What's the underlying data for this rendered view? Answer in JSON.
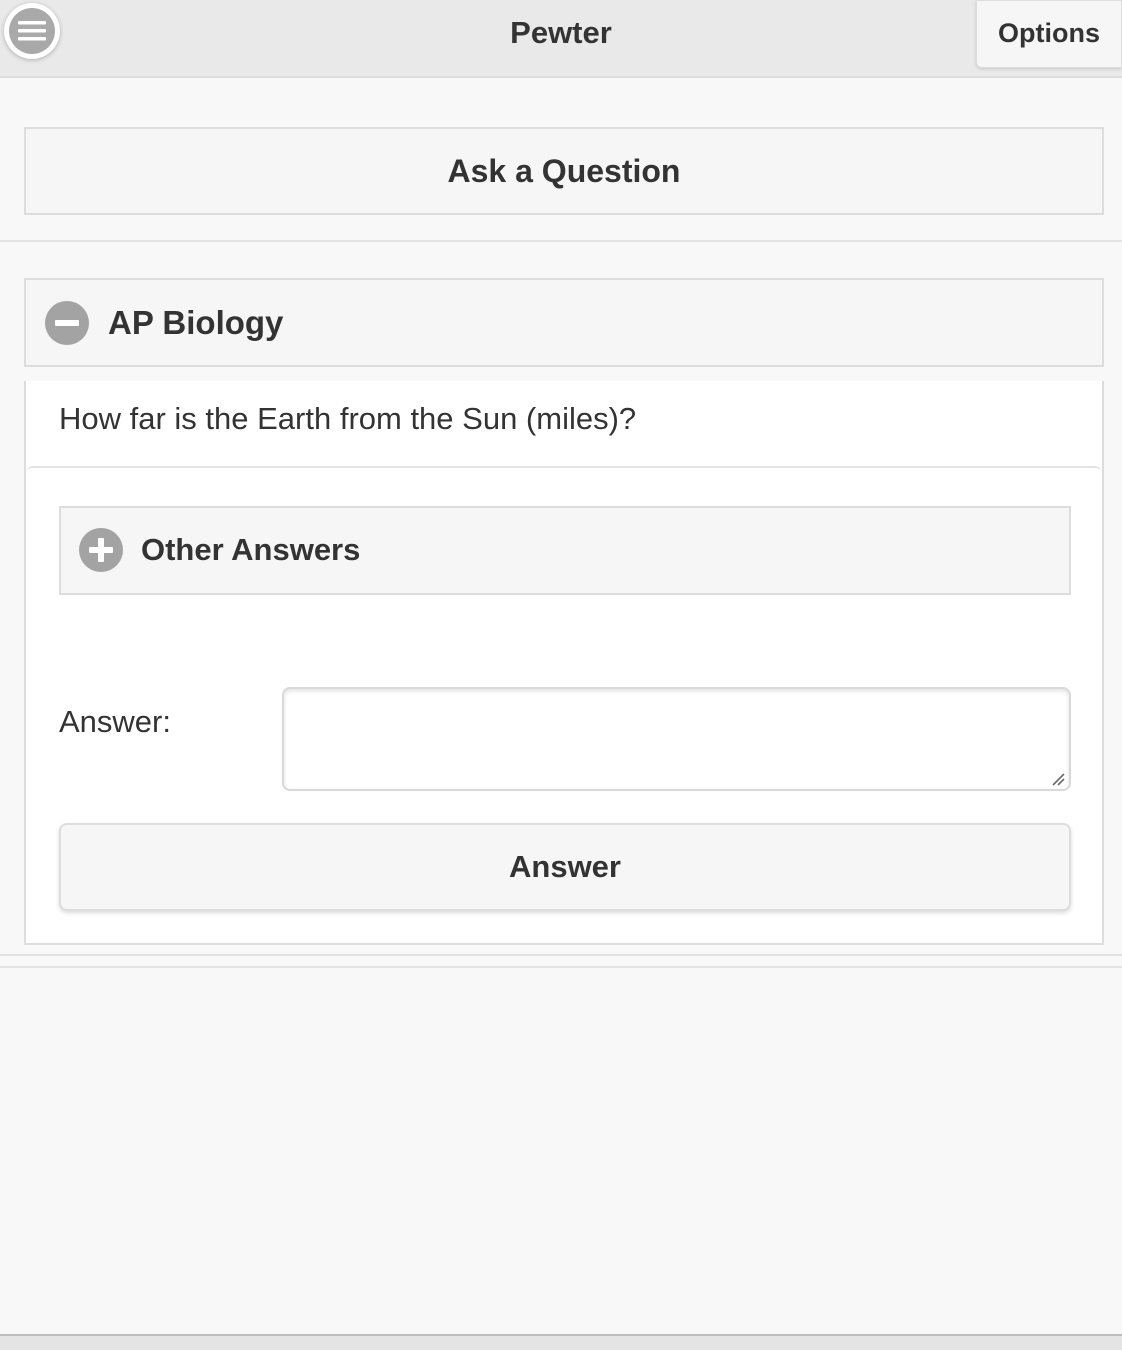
{
  "header": {
    "title": "Pewter",
    "options_label": "Options",
    "menu_icon": "hamburger-menu-icon"
  },
  "ask": {
    "label": "Ask a Question"
  },
  "subject": {
    "title": "AP Biology",
    "icon": "minus-circle-icon",
    "expanded": true
  },
  "question": {
    "text": "How far is the Earth from the Sun (miles)?"
  },
  "other_answers": {
    "title": "Other Answers",
    "icon": "plus-circle-icon",
    "expanded": false
  },
  "answer_form": {
    "label": "Answer:",
    "value": "",
    "button_label": "Answer"
  },
  "colors": {
    "header_bg": "#e9e9e9",
    "page_bg": "#f8f8f8",
    "button_bg": "#f6f6f6",
    "icon_gray": "#a3a3a3",
    "text": "#333333"
  }
}
